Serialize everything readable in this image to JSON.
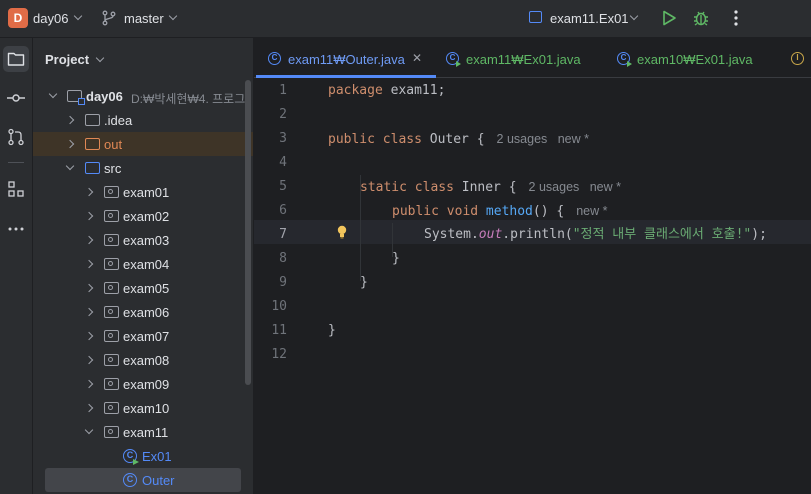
{
  "titlebar": {
    "project_badge": "D",
    "project_name": "day06",
    "branch": "master",
    "run_config": "exam11.Ex01"
  },
  "toolstrip": {
    "items": [
      "project-icon",
      "commit-icon",
      "vcs-icon",
      "structure-icon",
      "more-icon"
    ]
  },
  "project_panel": {
    "title": "Project",
    "root": {
      "name": "day06",
      "path": "D:₩박세현₩4. 프로그"
    },
    "items": [
      {
        "label": ".idea"
      },
      {
        "label": "out"
      },
      {
        "label": "src"
      },
      {
        "label": "exam01"
      },
      {
        "label": "exam02"
      },
      {
        "label": "exam03"
      },
      {
        "label": "exam04"
      },
      {
        "label": "exam05"
      },
      {
        "label": "exam06"
      },
      {
        "label": "exam07"
      },
      {
        "label": "exam08"
      },
      {
        "label": "exam09"
      },
      {
        "label": "exam10"
      },
      {
        "label": "exam11"
      },
      {
        "label": "Ex01"
      },
      {
        "label": "Outer"
      }
    ]
  },
  "editor": {
    "tabs": [
      {
        "label": "exam11₩Outer.java",
        "active": true
      },
      {
        "label": "exam11₩Ex01.java",
        "active": false
      },
      {
        "label": "exam10₩Ex01.java",
        "active": false
      }
    ],
    "line_numbers": [
      "1",
      "2",
      "3",
      "4",
      "5",
      "6",
      "7",
      "8",
      "9",
      "10",
      "11",
      "12"
    ],
    "current_line": "7",
    "code": {
      "l1_kw": "package",
      "l1_rest": " exam11;",
      "l3_kw": "public class",
      "l3_rest": " Outer {",
      "l3_hint": "2 usages   new *",
      "l5_kw": "static class",
      "l5_rest": " Inner {",
      "l5_hint": "2 usages   new *",
      "l6_kw": "public void",
      "l6_fn": "method",
      "l6_rest": "() {",
      "l6_hint": "new *",
      "l7_a": "System.",
      "l7_b": "out",
      "l7_c": ".println(",
      "l7_str": "\"정적 내부 클래스에서 호출!\"",
      "l7_end": ");",
      "l8": "}",
      "l9": "}",
      "l11": "}"
    }
  }
}
